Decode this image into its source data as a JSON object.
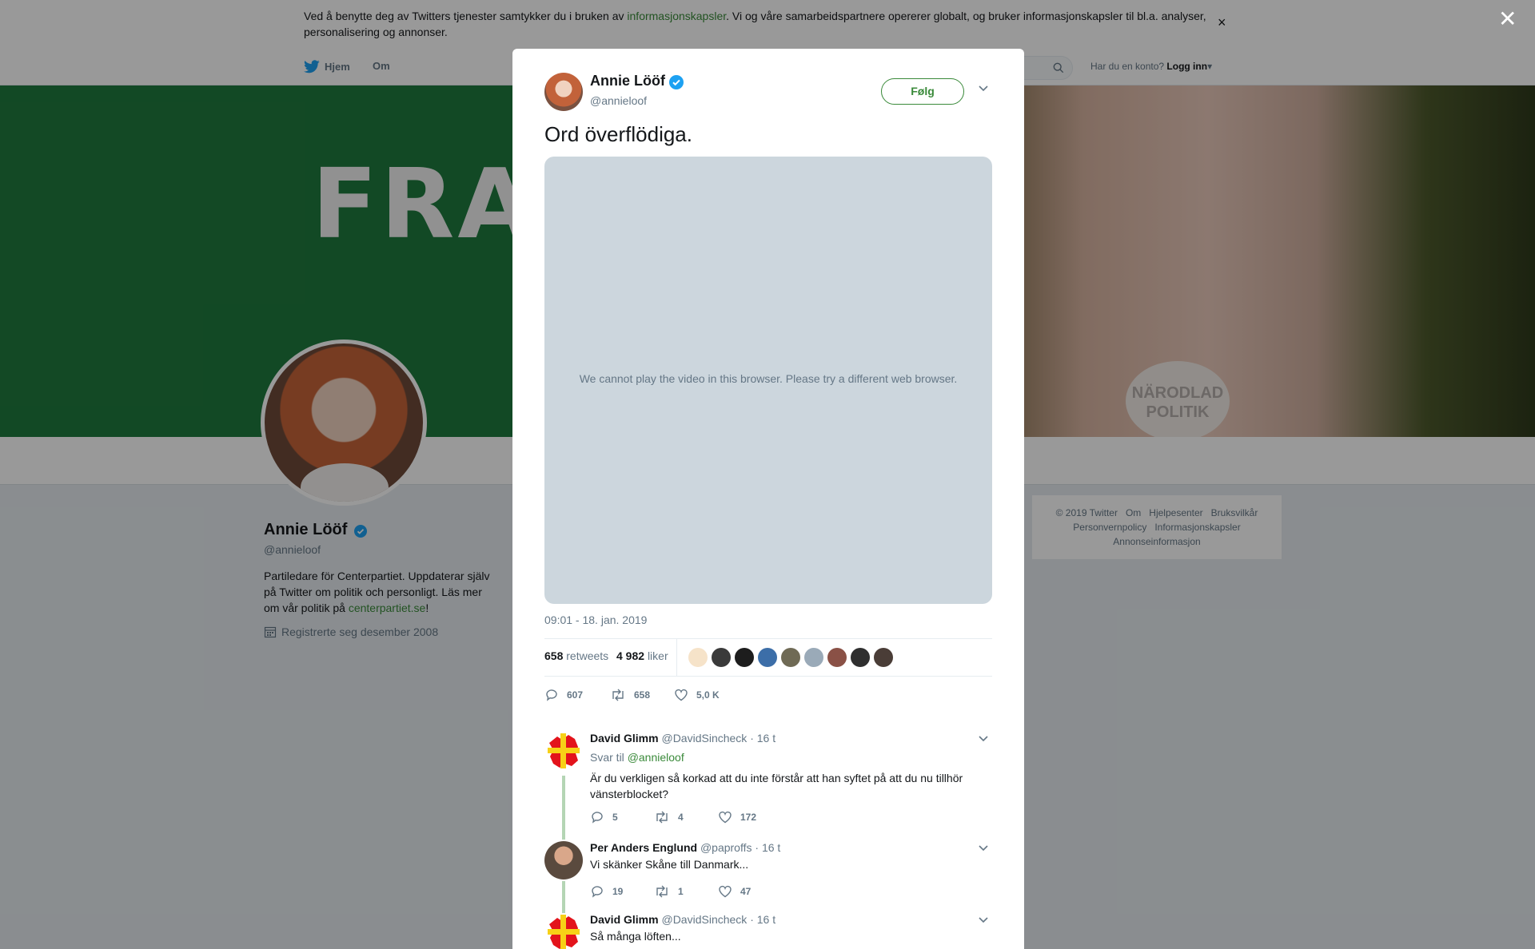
{
  "cookie": {
    "text_before": "Ved å benytte deg av Twitters tjenester samtykker du i bruken av ",
    "link": "informasjonskapsler",
    "text_after": ". Vi og våre samarbeidspartnere opererer globalt, og bruker informasjonskapsler til bl.a. analyser, personalisering og annonser.",
    "close": "×"
  },
  "nav": {
    "home": "Hjem",
    "about": "Om",
    "login_prompt": "Har du en konto?",
    "login": "Logg inn",
    "login_caret": "▾"
  },
  "banner": {
    "text": "FRAM",
    "badge_line1": "NÄRODLAD",
    "badge_line2": "POLITIK"
  },
  "profile": {
    "name": "Annie Lööf",
    "handle": "@annieloof",
    "bio_text": "Partiledare för Centerpartiet. Uppdaterar själv på Twitter om politik och personligt. Läs mer om vår politik på ",
    "bio_link": "centerpartiet.se",
    "bio_end": "!",
    "joined": "Registrerte seg desember 2008"
  },
  "footer": {
    "line1": [
      "© 2019 Twitter",
      "Om",
      "Hjelpesenter",
      "Bruksvilkår"
    ],
    "line2": [
      "Personvernpolicy",
      "Informasjonskapsler"
    ],
    "line3": [
      "Annonseinformasjon"
    ]
  },
  "overlay": {
    "close": "✕"
  },
  "tweet": {
    "name": "Annie Lööf",
    "handle": "@annieloof",
    "follow": "Følg",
    "text": "Ord överflödiga.",
    "video_message": "We cannot play the video in this browser. Please try a different web browser.",
    "timestamp": "09:01 - 18. jan. 2019",
    "retweets_count": "658",
    "retweets_label": "retweets",
    "likes_count": "4 982",
    "likes_label": "liker",
    "actions": {
      "replies": "607",
      "retweets": "658",
      "likes": "5,0 K"
    },
    "liker_colors": [
      "#f6e3c9",
      "#3a3a3a",
      "#1d1d1d",
      "#3c6ea8",
      "#6f6a55",
      "#9aaab8",
      "#8a5146",
      "#2f2f2f",
      "#4a3d37"
    ]
  },
  "replies": [
    {
      "name": "David Glimm",
      "handle": "@DavidSincheck",
      "time": "· 16 t",
      "reply_to_label": "Svar til",
      "reply_to": "@annieloof",
      "text": "Är du verkligen så korkad att du inte förstår att han syftet på att du nu tillhör vänsterblocket?",
      "replies": "5",
      "retweets": "4",
      "likes": "172"
    },
    {
      "name": "Per Anders Englund",
      "handle": "@paproffs",
      "time": "· 16 t",
      "text": "Vi skänker Skåne till Danmark...",
      "replies": "19",
      "retweets": "1",
      "likes": "47"
    },
    {
      "name": "David Glimm",
      "handle": "@DavidSincheck",
      "time": "· 16 t",
      "text": "Så många löften..."
    }
  ],
  "colors": {
    "accent": "#3a8a3a",
    "verified": "#1da1f2",
    "muted": "#657786"
  }
}
